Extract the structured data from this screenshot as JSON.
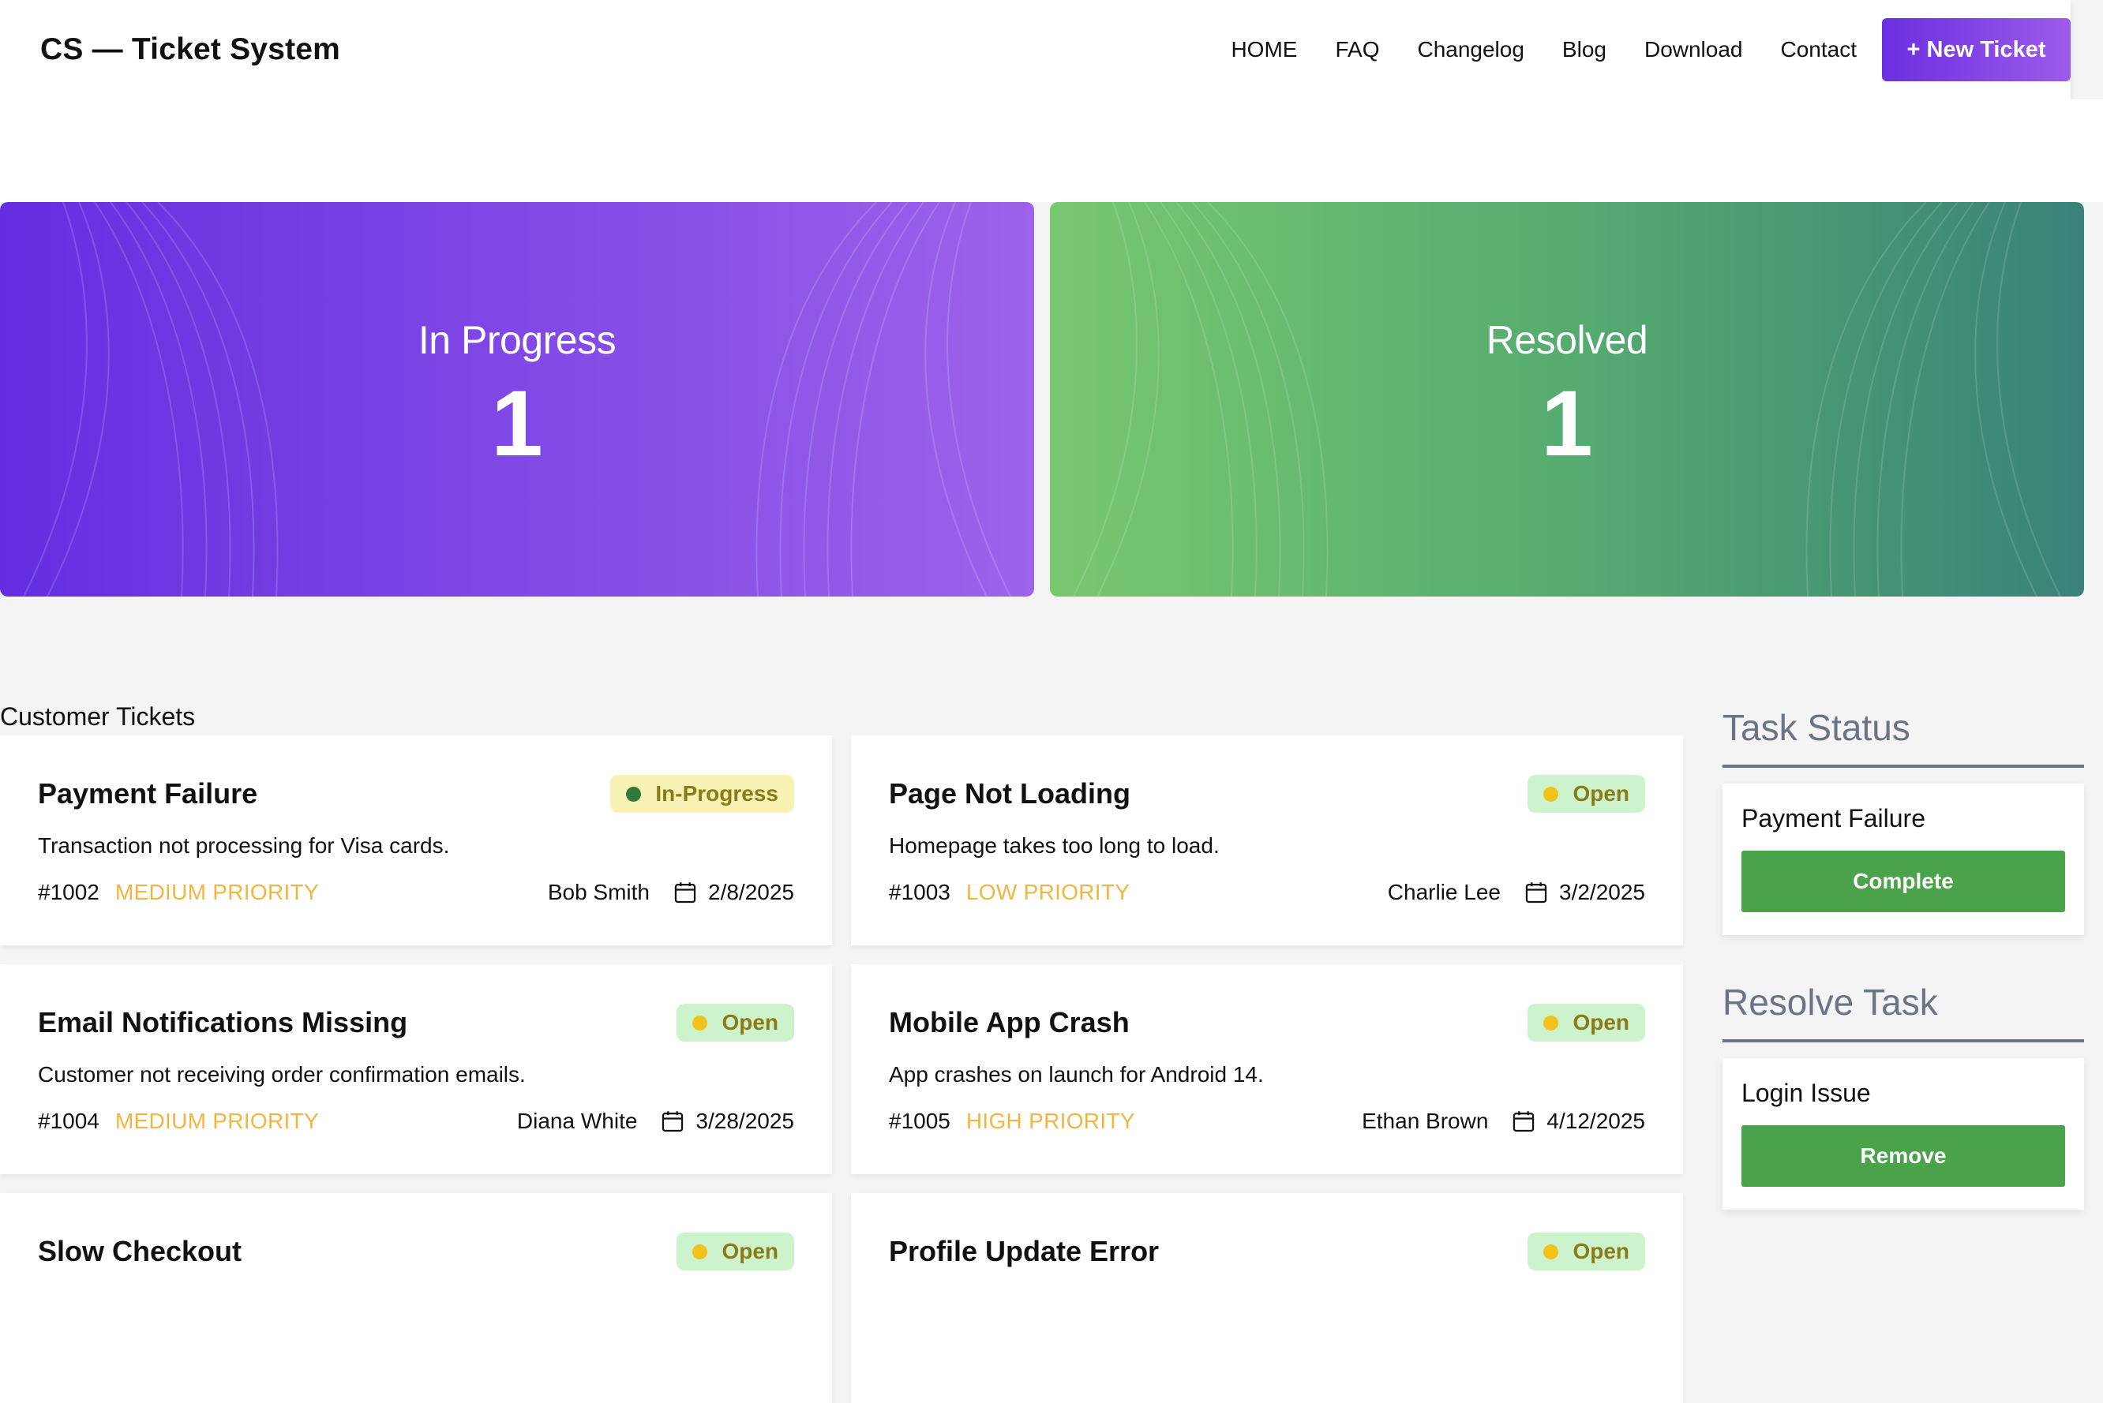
{
  "header": {
    "brand": "CS — Ticket System",
    "nav": [
      "HOME",
      "FAQ",
      "Changelog",
      "Blog",
      "Download",
      "Contact"
    ],
    "new_ticket_label": "+ New Ticket"
  },
  "stats": {
    "in_progress": {
      "label": "In Progress",
      "count": "1"
    },
    "resolved": {
      "label": "Resolved",
      "count": "1"
    }
  },
  "tickets_section_title": "Customer Tickets",
  "tickets": [
    {
      "title": "Payment Failure",
      "status": "In-Progress",
      "description": "Transaction not processing for Visa cards.",
      "id": "#1002",
      "priority": "MEDIUM PRIORITY",
      "customer": "Bob Smith",
      "date": "2/8/2025"
    },
    {
      "title": "Page Not Loading",
      "status": "Open",
      "description": "Homepage takes too long to load.",
      "id": "#1003",
      "priority": "LOW PRIORITY",
      "customer": "Charlie Lee",
      "date": "3/2/2025"
    },
    {
      "title": "Email Notifications Missing",
      "status": "Open",
      "description": "Customer not receiving order confirmation emails.",
      "id": "#1004",
      "priority": "MEDIUM PRIORITY",
      "customer": "Diana White",
      "date": "3/28/2025"
    },
    {
      "title": "Mobile App Crash",
      "status": "Open",
      "description": "App crashes on launch for Android 14.",
      "id": "#1005",
      "priority": "HIGH PRIORITY",
      "customer": "Ethan Brown",
      "date": "4/12/2025"
    },
    {
      "title": "Slow Checkout",
      "status": "Open"
    },
    {
      "title": "Profile Update Error",
      "status": "Open"
    }
  ],
  "side": {
    "task_status": {
      "heading": "Task Status",
      "item_title": "Payment Failure",
      "button_label": "Complete"
    },
    "resolve_task": {
      "heading": "Resolve Task",
      "item_title": "Login Issue",
      "button_label": "Remove"
    }
  },
  "colors": {
    "accent_purple": "#6a2fe0",
    "resolved_green": "#52a870",
    "button_green": "#4aa34a",
    "priority_yellow": "#f2b640",
    "heading_gray": "#6b7484"
  },
  "icons": {
    "date": "calendar-icon",
    "status": "status-dot-icon"
  }
}
